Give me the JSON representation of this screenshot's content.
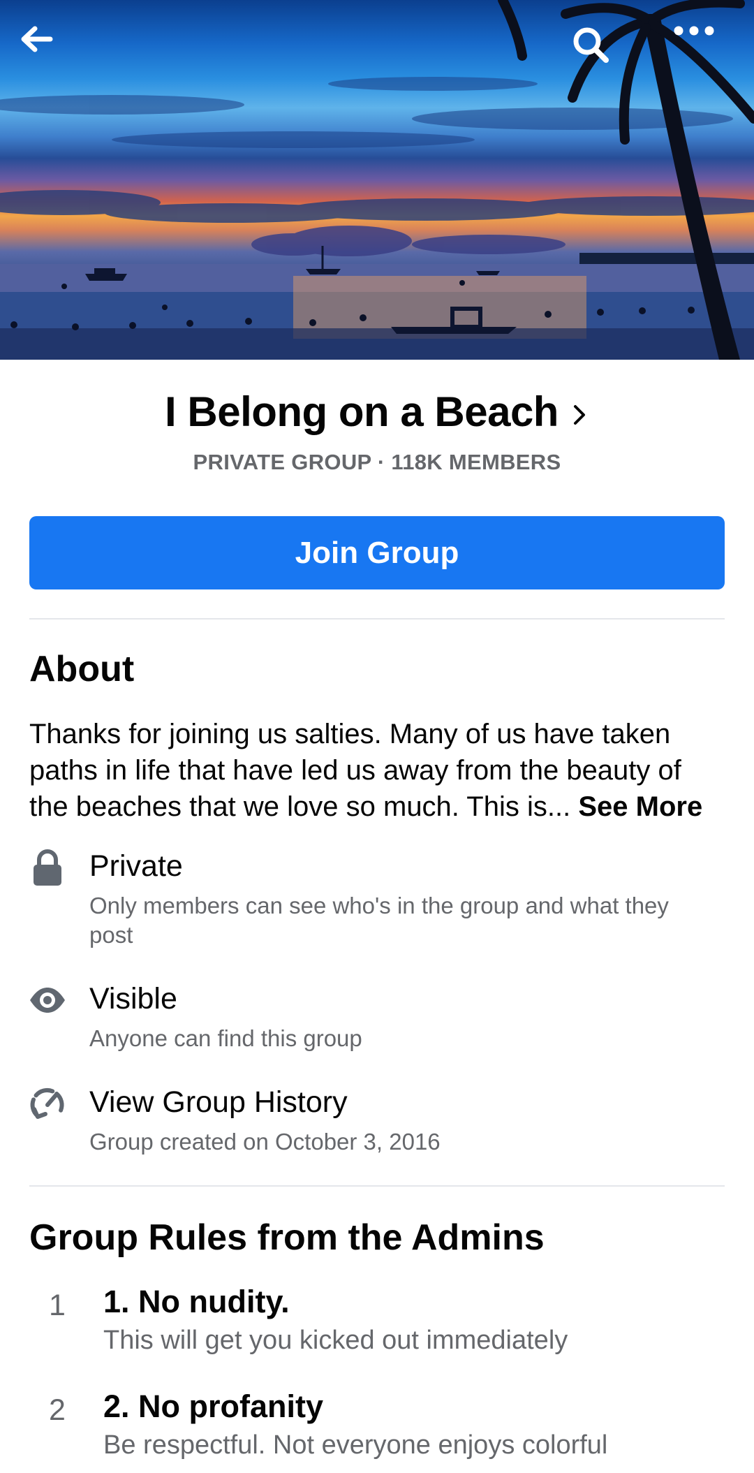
{
  "cover": {
    "image": "beach-sunset-cover",
    "actions": {
      "back_icon": "arrow-left-icon",
      "search_icon": "search-icon",
      "more_icon": "more-horizontal-icon"
    }
  },
  "group": {
    "name": "I Belong on a Beach",
    "meta": "PRIVATE GROUP · 118K MEMBERS",
    "join_label": "Join Group"
  },
  "about": {
    "heading": "About",
    "description": "Thanks for joining us salties. Many of us have taken paths in life that have led us away from the beauty of the beaches that we love so much. This is...",
    "see_more": "See More",
    "items": [
      {
        "icon": "lock-icon",
        "title": "Private",
        "description": "Only members can see who's in the group and what they post"
      },
      {
        "icon": "eye-icon",
        "title": "Visible",
        "description": "Anyone can find this group"
      },
      {
        "icon": "history-icon",
        "title": "View Group History",
        "description": "Group created on October 3, 2016"
      }
    ]
  },
  "rules": {
    "heading": "Group Rules from the Admins",
    "items": [
      {
        "number": "1",
        "title": "1. No nudity.",
        "description": "This will get you kicked out immediately"
      },
      {
        "number": "2",
        "title": "2. No profanity",
        "description": "Be respectful. Not everyone enjoys colorful"
      }
    ]
  },
  "colors": {
    "accent": "#1877f2",
    "text_primary": "#050505",
    "text_secondary": "#65676b",
    "divider": "#e4e6eb"
  }
}
